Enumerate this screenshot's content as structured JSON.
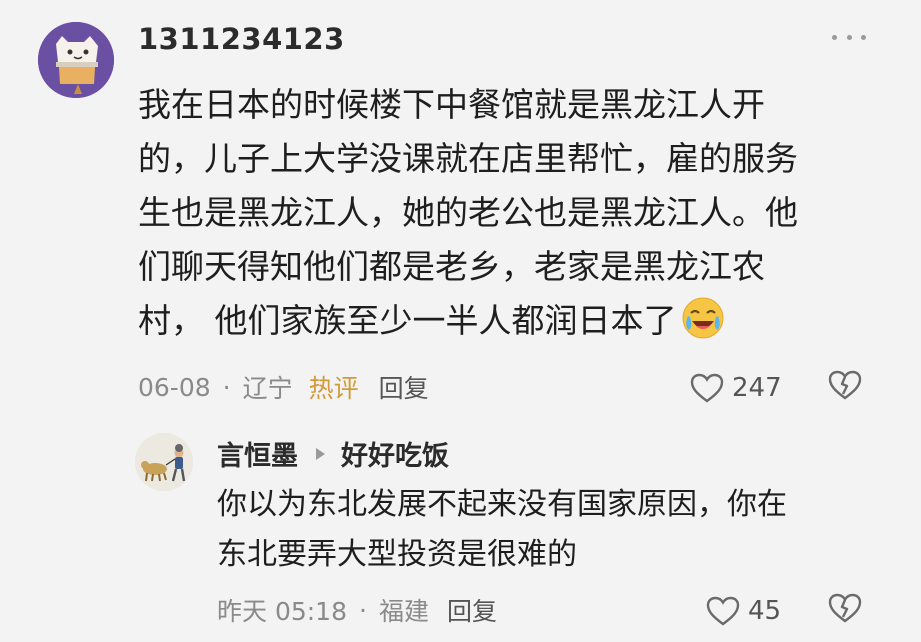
{
  "comment": {
    "username": "1311234123",
    "text": "我在日本的时候楼下中餐馆就是黑龙江人开\n的，儿子上大学没课就在店里帮忙，雇的服务\n生也是黑龙江人，她的老公也是黑龙江人。他\n们聊天得知他们都是老乡，老家是黑龙江农\n村， 他们家族至少一半人都润日本了",
    "emoji": "crying-laughing-emoji",
    "date": "06-08",
    "separator": "·",
    "location": "辽宁",
    "hot_label": "热评",
    "reply_label": "回复",
    "like_count": "247",
    "icons": [
      "more-icon",
      "heart-icon",
      "dislike-icon"
    ]
  },
  "reply": {
    "username": "言恒墨",
    "reply_to": "好好吃饭",
    "text": "你以为东北发展不起来没有国家原因，你在\n东北要弄大型投资是很难的",
    "date": "昨天 05:18",
    "separator": "·",
    "location": "福建",
    "reply_label": "回复",
    "like_count": "45",
    "icons": [
      "arrow-right-icon",
      "heart-icon",
      "dislike-icon"
    ]
  },
  "colors": {
    "background": "#f3f3f3",
    "hot_accent": "#d39a3a",
    "meta_text": "#8a8a8a"
  }
}
